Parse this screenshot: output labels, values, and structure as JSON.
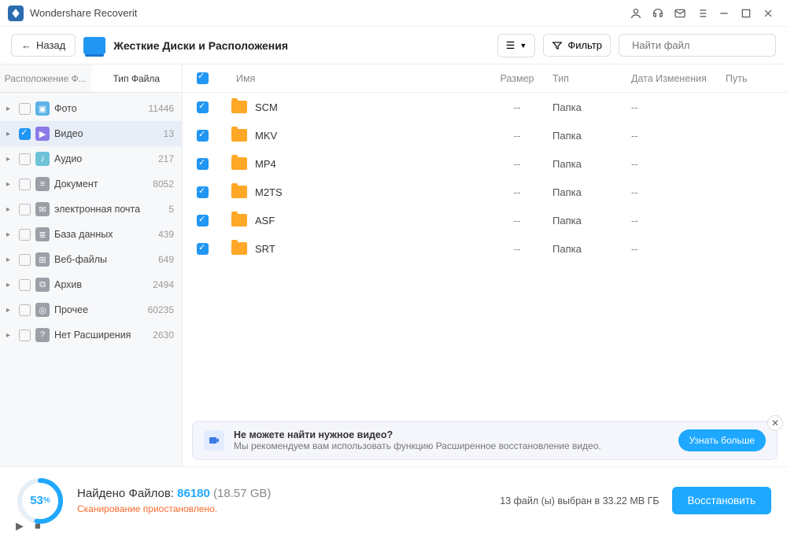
{
  "app_title": "Wondershare Recoverit",
  "toolbar": {
    "back_label": "Назад",
    "breadcrumb": "Жесткие Диски и Расположения",
    "filter_label": "Фильтр",
    "search_placeholder": "Найти файл"
  },
  "sidebar": {
    "tab_location": "Расположение Ф...",
    "tab_type": "Тип Файла",
    "categories": [
      {
        "label": "Фото",
        "count": "11446",
        "checked": false,
        "selected": false,
        "icon_bg": "#5bb3e8",
        "glyph": "▣"
      },
      {
        "label": "Видео",
        "count": "13",
        "checked": true,
        "selected": true,
        "icon_bg": "#8c7ae6",
        "glyph": "▶"
      },
      {
        "label": "Аудио",
        "count": "217",
        "checked": false,
        "selected": false,
        "icon_bg": "#6fc3d8",
        "glyph": "♪"
      },
      {
        "label": "Документ",
        "count": "8052",
        "checked": false,
        "selected": false,
        "icon_bg": "#9aa0a6",
        "glyph": "≡"
      },
      {
        "label": "электронная почта",
        "count": "5",
        "checked": false,
        "selected": false,
        "icon_bg": "#9aa0a6",
        "glyph": "✉"
      },
      {
        "label": "База данных",
        "count": "439",
        "checked": false,
        "selected": false,
        "icon_bg": "#9aa0a6",
        "glyph": "≣"
      },
      {
        "label": "Веб-файлы",
        "count": "649",
        "checked": false,
        "selected": false,
        "icon_bg": "#9aa0a6",
        "glyph": "⊞"
      },
      {
        "label": "Архив",
        "count": "2494",
        "checked": false,
        "selected": false,
        "icon_bg": "#9aa0a6",
        "glyph": "⧉"
      },
      {
        "label": "Прочее",
        "count": "60235",
        "checked": false,
        "selected": false,
        "icon_bg": "#9aa0a6",
        "glyph": "◎"
      },
      {
        "label": "Нет Расширения",
        "count": "2630",
        "checked": false,
        "selected": false,
        "icon_bg": "#9aa0a6",
        "glyph": "?"
      }
    ]
  },
  "table": {
    "headers": {
      "name": "Имя",
      "size": "Размер",
      "type": "Тип",
      "date": "Дата Изменения",
      "path": "Путь"
    },
    "rows": [
      {
        "name": "SCM",
        "size": "--",
        "type": "Папка",
        "date": "--",
        "checked": true
      },
      {
        "name": "MKV",
        "size": "--",
        "type": "Папка",
        "date": "--",
        "checked": true
      },
      {
        "name": "MP4",
        "size": "--",
        "type": "Папка",
        "date": "--",
        "checked": true
      },
      {
        "name": "M2TS",
        "size": "--",
        "type": "Папка",
        "date": "--",
        "checked": true
      },
      {
        "name": "ASF",
        "size": "--",
        "type": "Папка",
        "date": "--",
        "checked": true
      },
      {
        "name": "SRT",
        "size": "--",
        "type": "Папка",
        "date": "--",
        "checked": true
      }
    ]
  },
  "tip": {
    "title": "Не можете найти нужное видео?",
    "desc": "Мы рекомендуем вам использовать функцию Расширенное восстановление видео.",
    "learn_more": "Узнать больше"
  },
  "footer": {
    "progress_pct": "53",
    "progress_unit": "%",
    "found_label": "Найдено Файлов: ",
    "found_count": "86180",
    "found_size": " (18.57 GB)",
    "scan_status": "Сканирование приостановлено.",
    "selected_info": "13 файл (ы) выбран в 33.22 МВ ГБ",
    "recover_label": "Восстановить"
  }
}
